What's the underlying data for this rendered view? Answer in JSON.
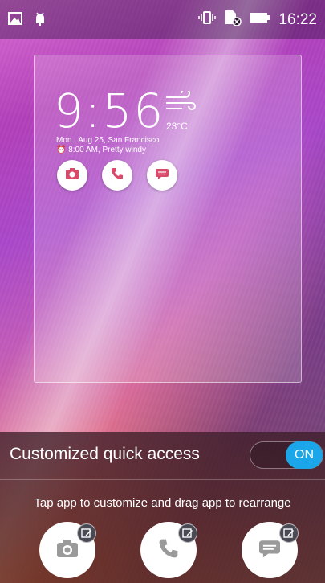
{
  "status_bar": {
    "time": "16:22",
    "left_icons": [
      "gallery-icon",
      "android-debug-icon"
    ],
    "right_icons": [
      "vibrate-icon",
      "sim-card-off-icon",
      "battery-icon"
    ]
  },
  "preview": {
    "clock": {
      "time": "9:56",
      "temperature": "23°C",
      "weather_icon": "wind-icon",
      "date_line": "Mon., Aug 25, San Francisco",
      "alarm_line": "8:00 AM, Pretty windy"
    },
    "shortcuts": [
      "camera-icon",
      "phone-icon",
      "message-icon"
    ]
  },
  "panel": {
    "title": "Customized quick access",
    "toggle_label": "ON",
    "hint": "Tap app to customize and drag app to rearrange",
    "shortcuts": [
      {
        "icon": "camera-icon"
      },
      {
        "icon": "phone-icon"
      },
      {
        "icon": "message-icon"
      }
    ]
  },
  "colors": {
    "toggle_on": "#1aa6e8"
  }
}
